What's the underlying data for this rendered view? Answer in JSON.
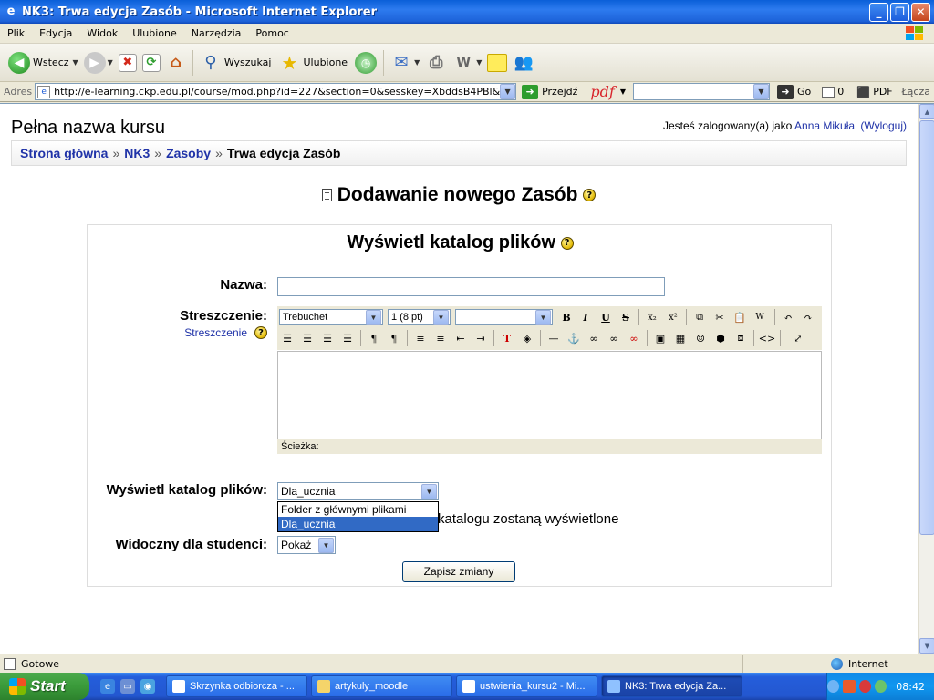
{
  "window": {
    "title": "NK3: Trwa edycja Zasób - Microsoft Internet Explorer"
  },
  "menu": [
    "Plik",
    "Edycja",
    "Widok",
    "Ulubione",
    "Narzędzia",
    "Pomoc"
  ],
  "toolbar": {
    "back_label": "Wstecz",
    "search_label": "Wyszukaj",
    "favorites_label": "Ulubione"
  },
  "address": {
    "label": "Adres",
    "url": "http://e-learning.ckp.edu.pl/course/mod.php?id=227&section=0&sesskey=XbddsB4PBl&add=resourc",
    "go_label": "Przejdź",
    "pdf_logo": "pdf",
    "go2_label": "Go",
    "count": "0",
    "pdf_label": "PDF",
    "links_label": "Łącza"
  },
  "page": {
    "course_title": "Pełna nazwa kursu",
    "login_prefix": "Jesteś zalogowany(a) jako ",
    "user_name": "Anna Mikuła",
    "logout": "(Wyloguj)",
    "breadcrumb": [
      "Strona główna",
      "NK3",
      "Zasoby",
      "Trwa edycja Zasób"
    ],
    "breadcrumb_sep": "»",
    "heading": "Dodawanie nowego Zasób",
    "form_title": "Wyświetl katalog plików",
    "name_label": "Nazwa:",
    "summary_label": "Streszczenie:",
    "summary_link": "Streszczenie",
    "editor": {
      "font": "Trebuchet",
      "size": "1 (8 pt)",
      "format": "",
      "path_label": "Ścieżka:"
    },
    "dir_label": "Wyświetl katalog plików:",
    "dir_value": "Dla_ucznia",
    "dir_options": [
      "Folder z głównymi plikami",
      "Dla_ucznia"
    ],
    "dir_note": "katalogu zostaną wyświetlone",
    "visible_label": "Widoczny dla studenci:",
    "visible_value": "Pokaż",
    "submit": "Zapisz zmiany",
    "help_glyph": "?"
  },
  "status": {
    "text": "Gotowe",
    "zone": "Internet"
  },
  "taskbar": {
    "start": "Start",
    "tasks": [
      "Skrzynka odbiorcza - ...",
      "artykuly_moodle",
      "ustwienia_kursu2 - Mi...",
      "NK3: Trwa edycja Za..."
    ],
    "clock": "08:42"
  },
  "colors": {
    "link": "#2033a8",
    "selection": "#316ac5",
    "titlebar": "#0a5fd8"
  }
}
